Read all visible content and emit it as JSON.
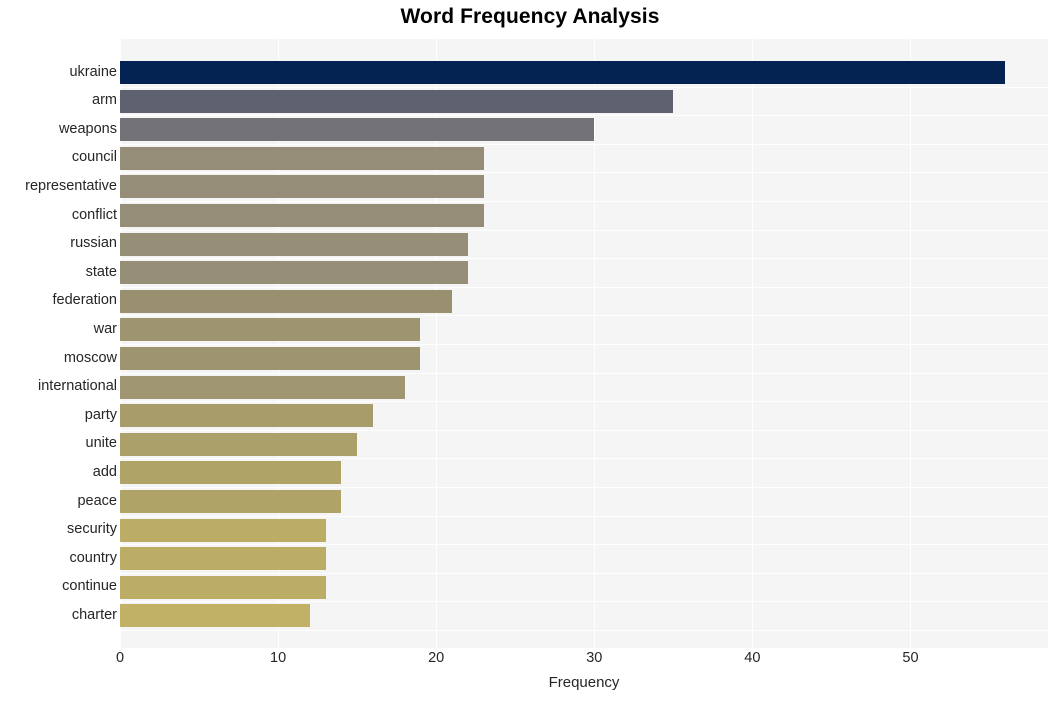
{
  "chart_data": {
    "type": "bar",
    "orientation": "horizontal",
    "title": "Word Frequency Analysis",
    "xlabel": "Frequency",
    "ylabel": "",
    "categories": [
      "ukraine",
      "arm",
      "weapons",
      "council",
      "representative",
      "conflict",
      "russian",
      "state",
      "federation",
      "war",
      "moscow",
      "international",
      "party",
      "unite",
      "add",
      "peace",
      "security",
      "country",
      "continue",
      "charter"
    ],
    "values": [
      56,
      35,
      30,
      23,
      23,
      23,
      22,
      22,
      21,
      19,
      19,
      18,
      16,
      15,
      14,
      14,
      13,
      13,
      13,
      12
    ],
    "bar_colors": [
      "#042252",
      "#5e6270",
      "#737377",
      "#958d77",
      "#958d77",
      "#958d77",
      "#968e77",
      "#968e77",
      "#99906f",
      "#9d9470",
      "#9d9470",
      "#a09672",
      "#a79c6a",
      "#ab9f6a",
      "#b0a368",
      "#b0a368",
      "#bbac66",
      "#bbac66",
      "#bbac66",
      "#c1b167"
    ],
    "xlim": [
      0,
      58.7
    ],
    "xticks": [
      0,
      10,
      20,
      30,
      40,
      50
    ],
    "xticklabels": [
      "0",
      "10",
      "20",
      "30",
      "40",
      "50"
    ],
    "grid": true,
    "grid_color": "#ffffff",
    "plot_background": "#f5f5f5",
    "figure_background": "#ffffff",
    "legend": null,
    "legend_position": "none"
  }
}
